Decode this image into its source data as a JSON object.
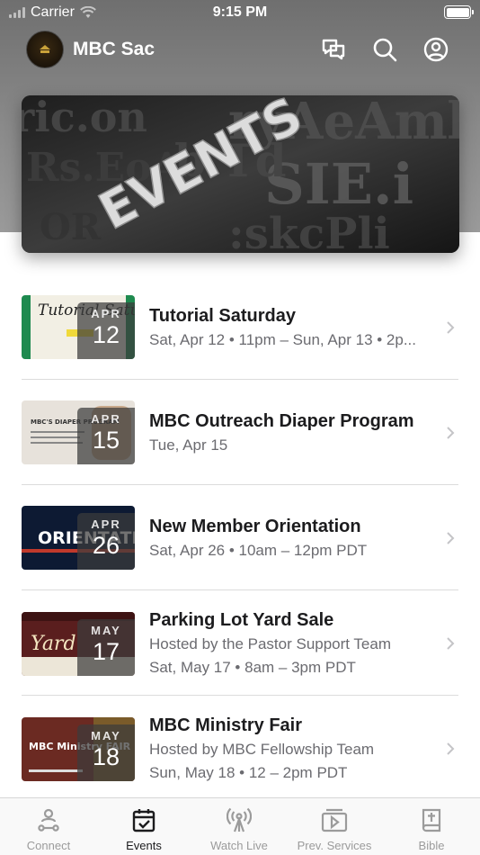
{
  "status_bar": {
    "carrier": "Carrier",
    "time": "9:15 PM"
  },
  "header": {
    "title": "MBC Sac",
    "icons": [
      "chat-icon",
      "search-icon",
      "profile-icon"
    ]
  },
  "banner": {
    "text": "EVENTS"
  },
  "events": [
    {
      "title": "Tutorial Saturday",
      "lines": [
        "Sat, Apr 12 • 11pm – Sun, Apr 13 • 2p..."
      ],
      "month": "APR",
      "day": "12",
      "thumb_text": "Tutorial Saturday"
    },
    {
      "title": "MBC Outreach Diaper Program",
      "lines": [
        "Tue, Apr 15"
      ],
      "month": "APR",
      "day": "15",
      "thumb_text": "MBC'S DIAPER PROGRAM"
    },
    {
      "title": "New Member Orientation",
      "lines": [
        "Sat, Apr 26 • 10am – 12pm PDT"
      ],
      "month": "APR",
      "day": "26",
      "thumb_text": "ORIENTATION"
    },
    {
      "title": "Parking Lot Yard Sale",
      "lines": [
        "Hosted by the Pastor Support Team",
        "Sat, May 17 • 8am – 3pm PDT"
      ],
      "month": "MAY",
      "day": "17",
      "thumb_text": "Yard"
    },
    {
      "title": "MBC Ministry Fair",
      "lines": [
        "Hosted by MBC Fellowship Team",
        "Sun, May 18 • 12 – 2pm PDT"
      ],
      "month": "MAY",
      "day": "18",
      "thumb_text": "MBC Ministry FAIR"
    }
  ],
  "tabs": [
    {
      "label": "Connect",
      "icon": "connect-icon",
      "active": false
    },
    {
      "label": "Events",
      "icon": "calendar-icon",
      "active": true
    },
    {
      "label": "Watch Live",
      "icon": "broadcast-icon",
      "active": false
    },
    {
      "label": "Prev. Services",
      "icon": "video-icon",
      "active": false
    },
    {
      "label": "Bible",
      "icon": "bible-icon",
      "active": false
    }
  ],
  "colors": {
    "header_gray": "#7d7d7d",
    "text_primary": "#1c1c1e",
    "text_secondary": "#6b6b70",
    "tab_inactive": "#9b9b9b"
  }
}
